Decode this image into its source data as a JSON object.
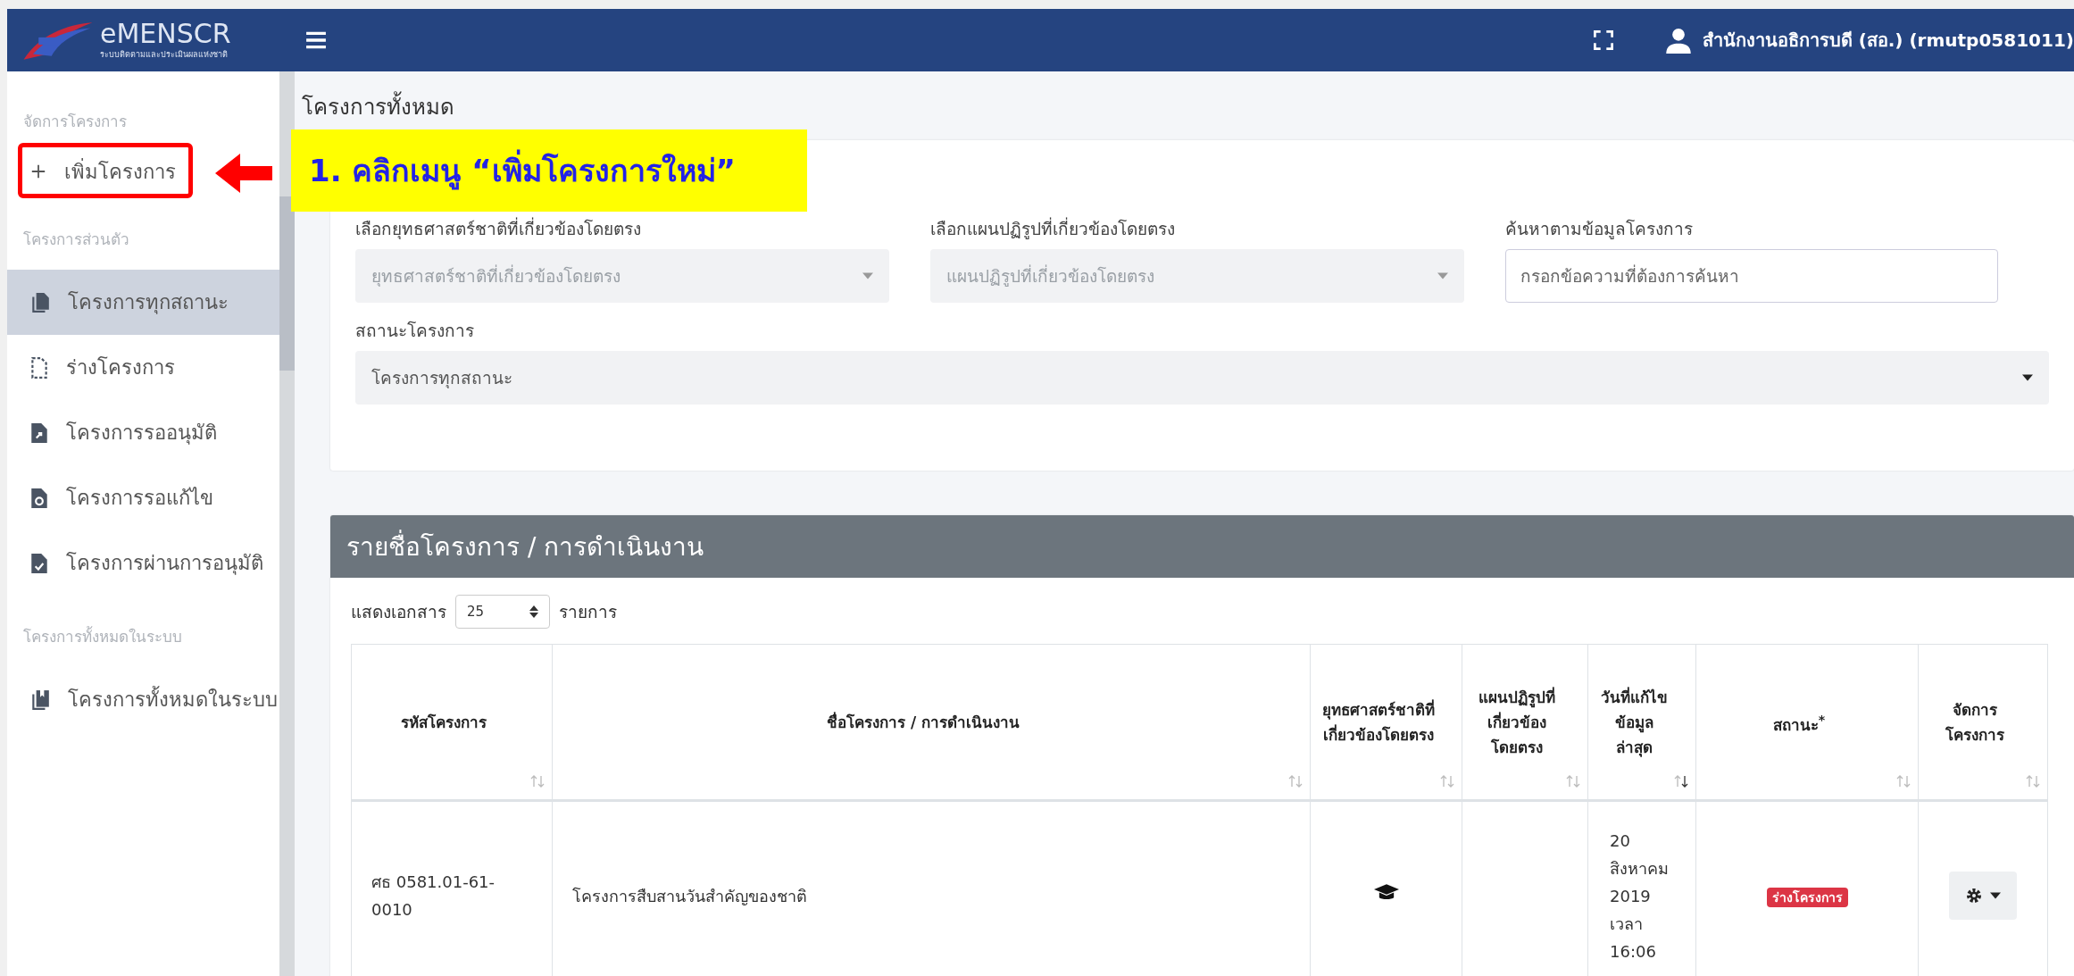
{
  "header": {
    "logo_title": "eMENSCR",
    "logo_subtitle": "ระบบติดตามและประเมินผลแห่งชาติ",
    "user": "สำนักงานอธิการบดี (สอ.) (rmutp0581011)"
  },
  "sidebar": {
    "sections": [
      {
        "heading": "จัดการโครงการ",
        "items": [
          {
            "label": "เพิ่มโครงการ",
            "kind": "add",
            "selected": false
          }
        ]
      },
      {
        "heading": "โครงการส่วนตัว",
        "items": [
          {
            "label": "โครงการทุกสถานะ",
            "kind": "all",
            "selected": true
          },
          {
            "label": "ร่างโครงการ",
            "kind": "draft",
            "selected": false
          },
          {
            "label": "โครงการรออนุมัติ",
            "kind": "pending",
            "selected": false
          },
          {
            "label": "โครงการรอแก้ไข",
            "kind": "revise",
            "selected": false
          },
          {
            "label": "โครงการผ่านการอนุมัติ",
            "kind": "approved",
            "selected": false
          }
        ]
      },
      {
        "heading": "โครงการทั้งหมดในระบบ",
        "items": [
          {
            "label": "โครงการทั้งหมดในระบบ",
            "kind": "system",
            "selected": false
          }
        ]
      }
    ]
  },
  "page_title": "โครงการทั้งหมด",
  "filters": {
    "fields": [
      {
        "label": "เลือกยุทธศาสตร์ชาติที่เกี่ยวข้องโดยตรง",
        "placeholder": "ยุทธศาสตร์ชาติที่เกี่ยวข้องโดยตรง",
        "kind": "select",
        "disabled": true
      },
      {
        "label": "เลือกแผนปฏิรูปที่เกี่ยวข้องโดยตรง",
        "placeholder": "แผนปฏิรูปที่เกี่ยวข้องโดยตรง",
        "kind": "select",
        "disabled": true
      },
      {
        "label": "ค้นหาตามข้อมูลโครงการ",
        "placeholder": "กรอกข้อความที่ต้องการค้นหา",
        "kind": "search"
      }
    ],
    "status": {
      "label": "สถานะโครงการ",
      "value": "โครงการทุกสถานะ"
    }
  },
  "table_card": {
    "title": "รายชื่อโครงการ / การดำเนินงาน",
    "page_size_label": "แสดงเอกสาร",
    "page_size": "25",
    "page_size_unit": "รายการ",
    "columns": [
      {
        "label": "รหัสโครงการ",
        "sorted": false
      },
      {
        "label": "ชื่อโครงการ / การดำเนินงาน",
        "sorted": false
      },
      {
        "label": "ยุทธศาสตร์ชาติที่เกี่ยวข้องโดยตรง",
        "sorted": false
      },
      {
        "label": "แผนปฏิรูปที่เกี่ยวข้องโดยตรง",
        "sorted": false
      },
      {
        "label": "วันที่แก้ไขข้อมูลล่าสุด",
        "sorted": true
      },
      {
        "label": "สถานะ$^{*}$",
        "sorted": false
      },
      {
        "label": "จัดการโครงการ",
        "sorted": false
      }
    ],
    "rows": [
      {
        "code": "ศธ 0581.01-61-0010",
        "name": "โครงการสืบสานวันสำคัญของชาติ",
        "strategy_linked": true,
        "updated": "20 สิงหาคม 2019 เวลา 16:06",
        "status": "ร่างโครงการ",
        "color": "#dc3545"
      }
    ]
  },
  "annotation": {
    "text": "1. คลิกเมนู “เพิ่มโครงการใหม่”"
  }
}
